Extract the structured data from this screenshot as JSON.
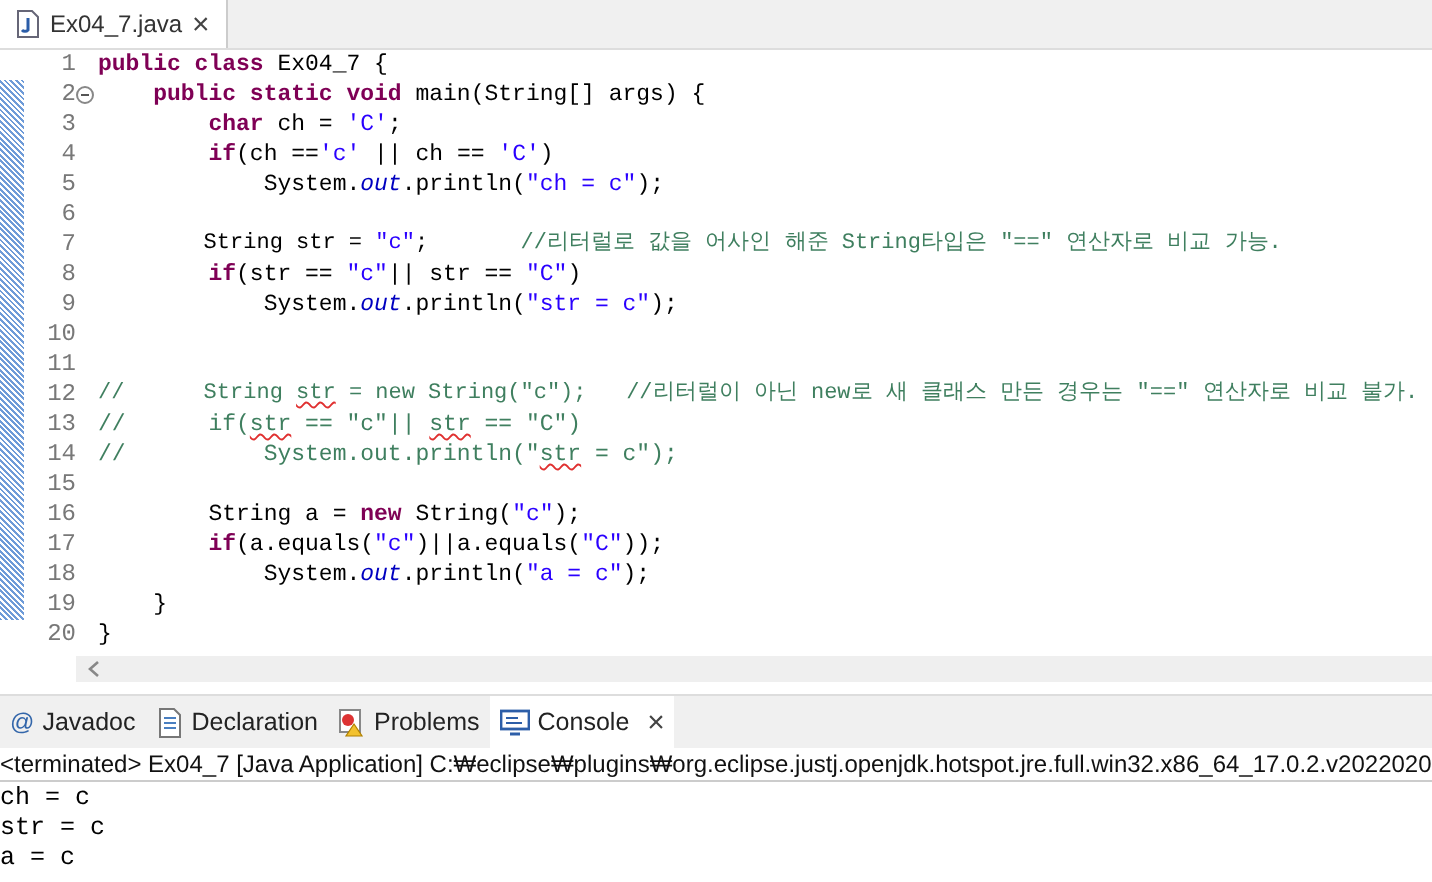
{
  "editor_tab": {
    "label": "Ex04_7.java",
    "close": "×",
    "selected": true
  },
  "code_lines": [
    {
      "number": "1",
      "tokens": [
        {
          "kind": "keyword",
          "text": "public class"
        },
        {
          "kind": "plain",
          "text": " Ex04_7 {"
        }
      ]
    },
    {
      "number": "2",
      "fold": true,
      "tokens": [
        {
          "kind": "keyword",
          "text": "    public static void"
        },
        {
          "kind": "plain",
          "text": " main(String[] args) {"
        }
      ]
    },
    {
      "number": "3",
      "tokens": [
        {
          "kind": "keyword",
          "text": "        char"
        },
        {
          "kind": "plain",
          "text": " ch = "
        },
        {
          "kind": "string",
          "text": "'C'"
        },
        {
          "kind": "plain",
          "text": ";"
        }
      ]
    },
    {
      "number": "4",
      "tokens": [
        {
          "kind": "keyword",
          "text": "        if"
        },
        {
          "kind": "plain",
          "text": "(ch =="
        },
        {
          "kind": "string",
          "text": "'c'"
        },
        {
          "kind": "plain",
          "text": " || ch == "
        },
        {
          "kind": "string",
          "text": "'C'"
        },
        {
          "kind": "plain",
          "text": ")"
        }
      ]
    },
    {
      "number": "5",
      "tokens": [
        {
          "kind": "plain",
          "text": "            System."
        },
        {
          "kind": "field",
          "text": "out"
        },
        {
          "kind": "plain",
          "text": ".println("
        },
        {
          "kind": "string",
          "text": "\"ch = c\""
        },
        {
          "kind": "plain",
          "text": ");"
        }
      ]
    },
    {
      "number": "6"
    },
    {
      "number": "7",
      "tokens": [
        {
          "kind": "plain",
          "text": "        String str = "
        },
        {
          "kind": "string",
          "text": "\"c\""
        },
        {
          "kind": "plain",
          "text": ";       "
        },
        {
          "kind": "comment",
          "text": "//리터럴로 값을 어사인 해준 String타입은 \"==\" 연산자로 비교 가능."
        }
      ]
    },
    {
      "number": "8",
      "tokens": [
        {
          "kind": "keyword",
          "text": "        if"
        },
        {
          "kind": "plain",
          "text": "(str == "
        },
        {
          "kind": "string",
          "text": "\"c\""
        },
        {
          "kind": "plain",
          "text": "|| str == "
        },
        {
          "kind": "string",
          "text": "\"C\""
        },
        {
          "kind": "plain",
          "text": ")"
        }
      ]
    },
    {
      "number": "9",
      "tokens": [
        {
          "kind": "plain",
          "text": "            System."
        },
        {
          "kind": "field",
          "text": "out"
        },
        {
          "kind": "plain",
          "text": ".println("
        },
        {
          "kind": "string",
          "text": "\"str = c\""
        },
        {
          "kind": "plain",
          "text": ");"
        }
      ]
    },
    {
      "number": "10"
    },
    {
      "number": "11"
    },
    {
      "number": "12",
      "tokens": [
        {
          "kind": "comment",
          "text": "//      String "
        },
        {
          "kind": "misspelled",
          "text": "str"
        },
        {
          "kind": "comment",
          "text": " = new String(\"c\");   //리터럴이 아닌 new로 새 클래스 만든 경우는 \"==\" 연산자로 비교 불가."
        }
      ]
    },
    {
      "number": "13",
      "tokens": [
        {
          "kind": "comment",
          "text": "//      if("
        },
        {
          "kind": "misspelled",
          "text": "str"
        },
        {
          "kind": "comment",
          "text": " == \"c\"|| "
        },
        {
          "kind": "misspelled",
          "text": "str"
        },
        {
          "kind": "comment",
          "text": " == \"C\")"
        }
      ]
    },
    {
      "number": "14",
      "tokens": [
        {
          "kind": "comment",
          "text": "//          System.out.println(\""
        },
        {
          "kind": "misspelled",
          "text": "str"
        },
        {
          "kind": "comment",
          "text": " = c\");"
        }
      ]
    },
    {
      "number": "15"
    },
    {
      "number": "16",
      "tokens": [
        {
          "kind": "plain",
          "text": "        String a = "
        },
        {
          "kind": "keyword",
          "text": "new"
        },
        {
          "kind": "plain",
          "text": " String("
        },
        {
          "kind": "string",
          "text": "\"c\""
        },
        {
          "kind": "plain",
          "text": ");"
        }
      ]
    },
    {
      "number": "17",
      "tokens": [
        {
          "kind": "keyword",
          "text": "        if"
        },
        {
          "kind": "plain",
          "text": "(a.equals("
        },
        {
          "kind": "string",
          "text": "\"c\""
        },
        {
          "kind": "plain",
          "text": ")||a.equals("
        },
        {
          "kind": "string",
          "text": "\"C\""
        },
        {
          "kind": "plain",
          "text": "));"
        }
      ]
    },
    {
      "number": "18",
      "tokens": [
        {
          "kind": "plain",
          "text": "            System."
        },
        {
          "kind": "field",
          "text": "out"
        },
        {
          "kind": "plain",
          "text": ".println("
        },
        {
          "kind": "string",
          "text": "\"a = c\""
        },
        {
          "kind": "plain",
          "text": ");"
        }
      ]
    },
    {
      "number": "19",
      "tokens": [
        {
          "kind": "plain",
          "text": "    }"
        }
      ]
    },
    {
      "number": "20",
      "tokens": [
        {
          "kind": "plain",
          "text": "}"
        }
      ]
    }
  ],
  "panel_tabs": [
    {
      "kind": "javadoc",
      "icon": "@",
      "label": "Javadoc",
      "selected": false
    },
    {
      "kind": "declaration",
      "label": "Declaration",
      "selected": false
    },
    {
      "kind": "problems",
      "label": "Problems",
      "selected": false
    },
    {
      "kind": "console",
      "label": "Console",
      "selected": true,
      "close": "×"
    }
  ],
  "console": {
    "status": "<terminated> Ex04_7 [Java Application] C:₩eclipse₩plugins₩org.eclipse.justj.openjdk.hotspot.jre.full.win32.x86_64_17.0.2.v2022020",
    "output": [
      "ch = c",
      "str = c",
      "a = c"
    ]
  }
}
